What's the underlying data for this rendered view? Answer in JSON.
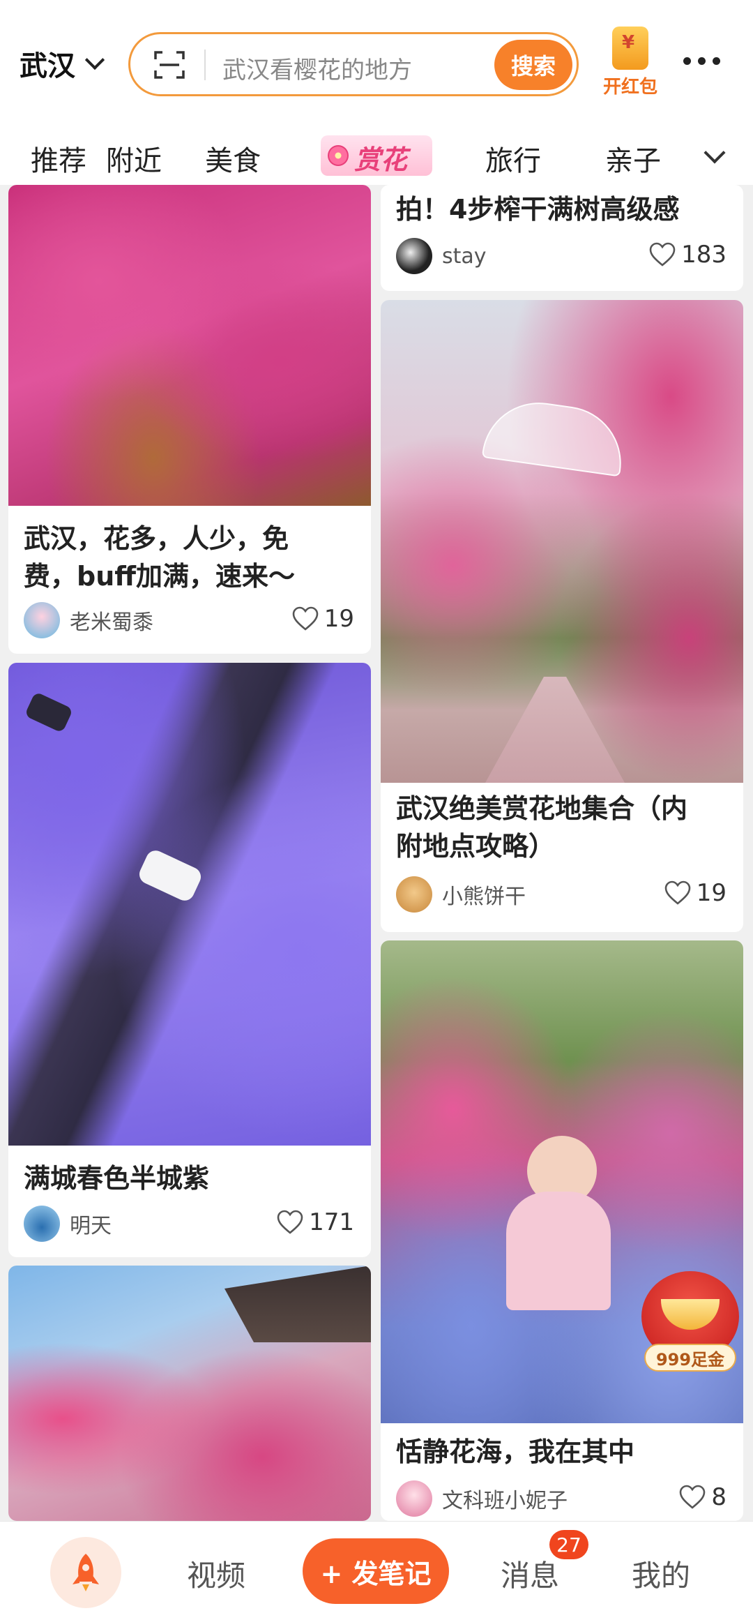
{
  "header": {
    "city": "武汉",
    "search_placeholder": "武汉看樱花的地方",
    "search_button": "搜索",
    "red_packet_label": "开红包"
  },
  "tabs": [
    {
      "label": "推荐"
    },
    {
      "label": "附近"
    },
    {
      "label": "美食"
    },
    {
      "label": "赏花",
      "active": true
    },
    {
      "label": "旅行"
    },
    {
      "label": "亲子"
    }
  ],
  "feed": {
    "left": [
      {
        "title_lines": [
          "武汉，花多，人少，免",
          "费，buff加满，速来～"
        ],
        "author": "老米蜀黍",
        "likes": "19"
      },
      {
        "title_lines": [
          "满城春色半城紫"
        ],
        "author": "明天",
        "likes": "171"
      },
      {
        "title_lines": [],
        "author": "",
        "likes": ""
      }
    ],
    "right": [
      {
        "title_lines": [
          "拍！4步榨干满树高级感"
        ],
        "author": "stay",
        "likes": "183"
      },
      {
        "title_lines": [
          "武汉绝美赏花地集合（内",
          "附地点攻略）"
        ],
        "author": "小熊饼干",
        "likes": "19"
      },
      {
        "title_lines": [
          "恬静花海，我在其中"
        ],
        "author": "文科班小妮子",
        "likes": "8"
      }
    ]
  },
  "promo_badge": {
    "label": "999足金"
  },
  "bottom_nav": {
    "video": "视频",
    "post": "+ 发笔记",
    "messages": "消息",
    "messages_badge": "27",
    "me": "我的"
  },
  "colors": {
    "accent": "#f7812a",
    "post_button": "#f7612a",
    "badge": "#f0451e"
  }
}
